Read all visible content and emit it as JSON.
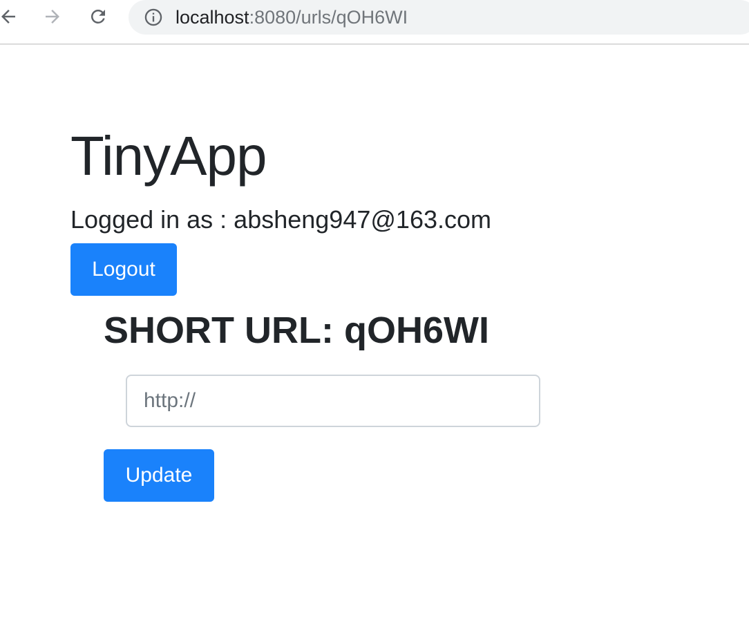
{
  "browser": {
    "url_host": "localhost",
    "url_rest": ":8080/urls/qOH6WI",
    "icons": [
      "back-arrow-icon",
      "forward-arrow-icon",
      "reload-icon",
      "info-icon"
    ]
  },
  "page": {
    "title": "TinyApp",
    "login_text": "Logged in as : absheng947@163.com",
    "logout_label": "Logout",
    "short_url_heading": "SHORT URL: qOH6WI",
    "long_url_input": {
      "value": "",
      "placeholder": "http://"
    },
    "update_label": "Update"
  },
  "colors": {
    "primary": "#1a82fb",
    "text": "#212529",
    "omnibox_bg": "#f1f3f4"
  }
}
